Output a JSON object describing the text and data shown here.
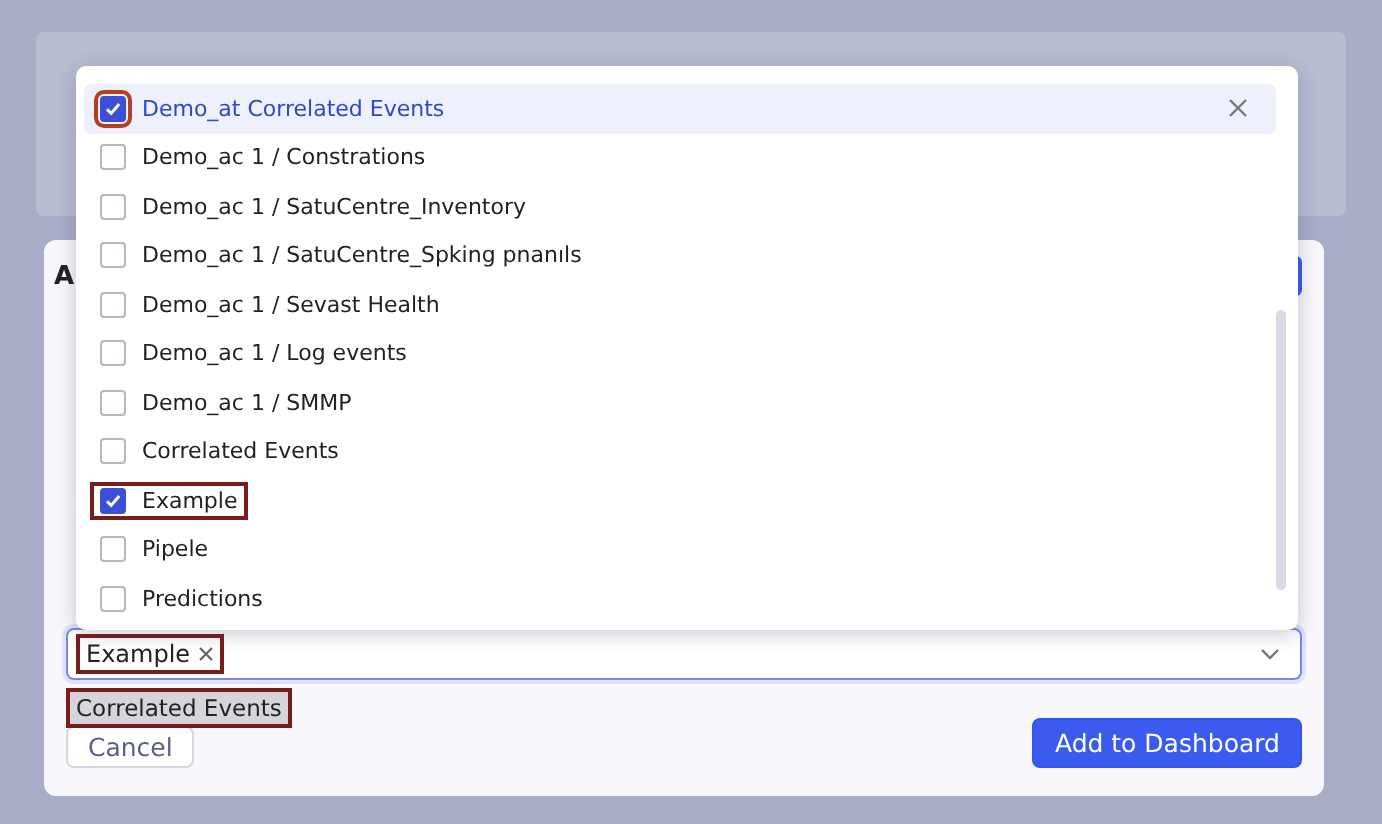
{
  "dialog": {
    "title": "A",
    "options": [
      {
        "label": "Demo_at Correlated Events",
        "checked": true,
        "active": true,
        "checkbox_highlighted": true
      },
      {
        "label": "Demo_ac 1 / Constrations",
        "checked": false,
        "active": false
      },
      {
        "label": "Demo_ac 1 / SatuCentre_Inventory",
        "checked": false,
        "active": false
      },
      {
        "label": "Demo_ac 1 / SatuCentre_Spking pnanıls",
        "checked": false,
        "active": false
      },
      {
        "label": "Demo_ac 1 / Sevast Health",
        "checked": false,
        "active": false
      },
      {
        "label": "Demo_ac 1 / Log events",
        "checked": false,
        "active": false
      },
      {
        "label": "Demo_ac 1 / SMMP",
        "checked": false,
        "active": false
      },
      {
        "label": "Correlated Events",
        "checked": false,
        "active": false
      },
      {
        "label": "Example",
        "checked": true,
        "active": false,
        "checkbox_highlighted": true,
        "label_highlighted": true
      },
      {
        "label": "Pipele",
        "checked": false,
        "active": false
      },
      {
        "label": "Predictions",
        "checked": false,
        "active": false
      }
    ],
    "selected_tags": [
      "Example"
    ],
    "suggestion": "Correlated Events",
    "buttons": [
      {
        "label": "Cancel",
        "kind": "secondary"
      },
      {
        "label": "Add to Dashboard",
        "kind": "primary"
      }
    ]
  }
}
